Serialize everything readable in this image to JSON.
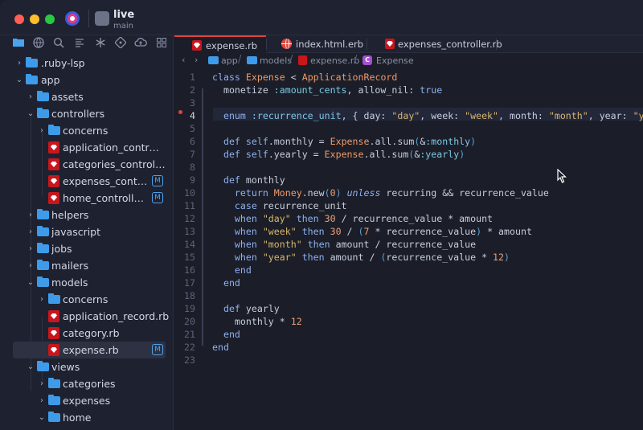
{
  "titlebar": {
    "project_name": "live",
    "branch": "main"
  },
  "sidebar": {
    "toolbar_icons": [
      "folder-icon",
      "globe-icon",
      "search-icon",
      "list-icon",
      "asterisk-icon",
      "git-icon",
      "cloud-upload-icon",
      "grid-icon"
    ],
    "tree": [
      {
        "label": ".ruby-lsp",
        "kind": "folder",
        "expanded": false
      },
      {
        "label": "app",
        "kind": "folder",
        "expanded": true
      },
      {
        "label": "assets",
        "kind": "folder",
        "expanded": false
      },
      {
        "label": "controllers",
        "kind": "folder",
        "expanded": true
      },
      {
        "label": "concerns",
        "kind": "folder",
        "expanded": false
      },
      {
        "label": "application_controlle...",
        "kind": "ruby"
      },
      {
        "label": "categories_controller...",
        "kind": "ruby"
      },
      {
        "label": "expenses_controll...",
        "kind": "ruby",
        "badge": "M"
      },
      {
        "label": "home_controller.rb",
        "kind": "ruby",
        "badge": "M"
      },
      {
        "label": "helpers",
        "kind": "folder",
        "expanded": false
      },
      {
        "label": "javascript",
        "kind": "folder",
        "expanded": false
      },
      {
        "label": "jobs",
        "kind": "folder",
        "expanded": false
      },
      {
        "label": "mailers",
        "kind": "folder",
        "expanded": false
      },
      {
        "label": "models",
        "kind": "folder",
        "expanded": true
      },
      {
        "label": "concerns",
        "kind": "folder",
        "expanded": false
      },
      {
        "label": "application_record.rb",
        "kind": "ruby"
      },
      {
        "label": "category.rb",
        "kind": "ruby"
      },
      {
        "label": "expense.rb",
        "kind": "ruby",
        "badge": "M",
        "selected": true
      },
      {
        "label": "views",
        "kind": "folder",
        "expanded": true
      },
      {
        "label": "categories",
        "kind": "folder",
        "expanded": false
      },
      {
        "label": "expenses",
        "kind": "folder",
        "expanded": false
      },
      {
        "label": "home",
        "kind": "folder",
        "expanded": true
      }
    ]
  },
  "tabs": [
    {
      "label": "expense.rb",
      "active": true,
      "icon": "ruby-icon"
    },
    {
      "label": "index.html.erb",
      "active": false,
      "icon": "globe-icon"
    },
    {
      "label": "expenses_controller.rb",
      "active": false,
      "icon": "ruby-icon"
    }
  ],
  "breadcrumb": {
    "parts": [
      "app",
      "models",
      "expense.rb",
      "Expense"
    ],
    "class_badge": "C"
  },
  "editor": {
    "current_line": 4,
    "breakpoint_line": 4,
    "line_numbers": [
      "1",
      "2",
      "3",
      "4",
      "5",
      "6",
      "7",
      "8",
      "9",
      "10",
      "11",
      "12",
      "13",
      "14",
      "15",
      "16",
      "17",
      "18",
      "19",
      "20",
      "21",
      "22",
      "23"
    ],
    "lines": [
      "class Expense < ApplicationRecord",
      "  monetize :amount_cents, allow_nil: true",
      "",
      "  enum :recurrence_unit, { day: \"day\", week: \"week\", month: \"month\", year: \"year\" }",
      "",
      "  def self.monthly = Expense.all.sum(&:monthly)",
      "  def self.yearly = Expense.all.sum(&:yearly)",
      "",
      "  def monthly",
      "    return Money.new(0) unless recurring && recurrence_value",
      "    case recurrence_unit",
      "    when \"day\" then 30 / recurrence_value * amount",
      "    when \"week\" then 30 / (7 * recurrence_value) * amount",
      "    when \"month\" then amount / recurrence_value",
      "    when \"year\" then amount / (recurrence_value * 12)",
      "    end",
      "  end",
      "",
      "  def yearly",
      "    monthly * 12",
      "  end",
      "end",
      ""
    ]
  },
  "colors": {
    "accent": "#3d9bea",
    "ruby": "#c8161d",
    "active_tab": "#e0443a",
    "background": "#1b1e28"
  }
}
